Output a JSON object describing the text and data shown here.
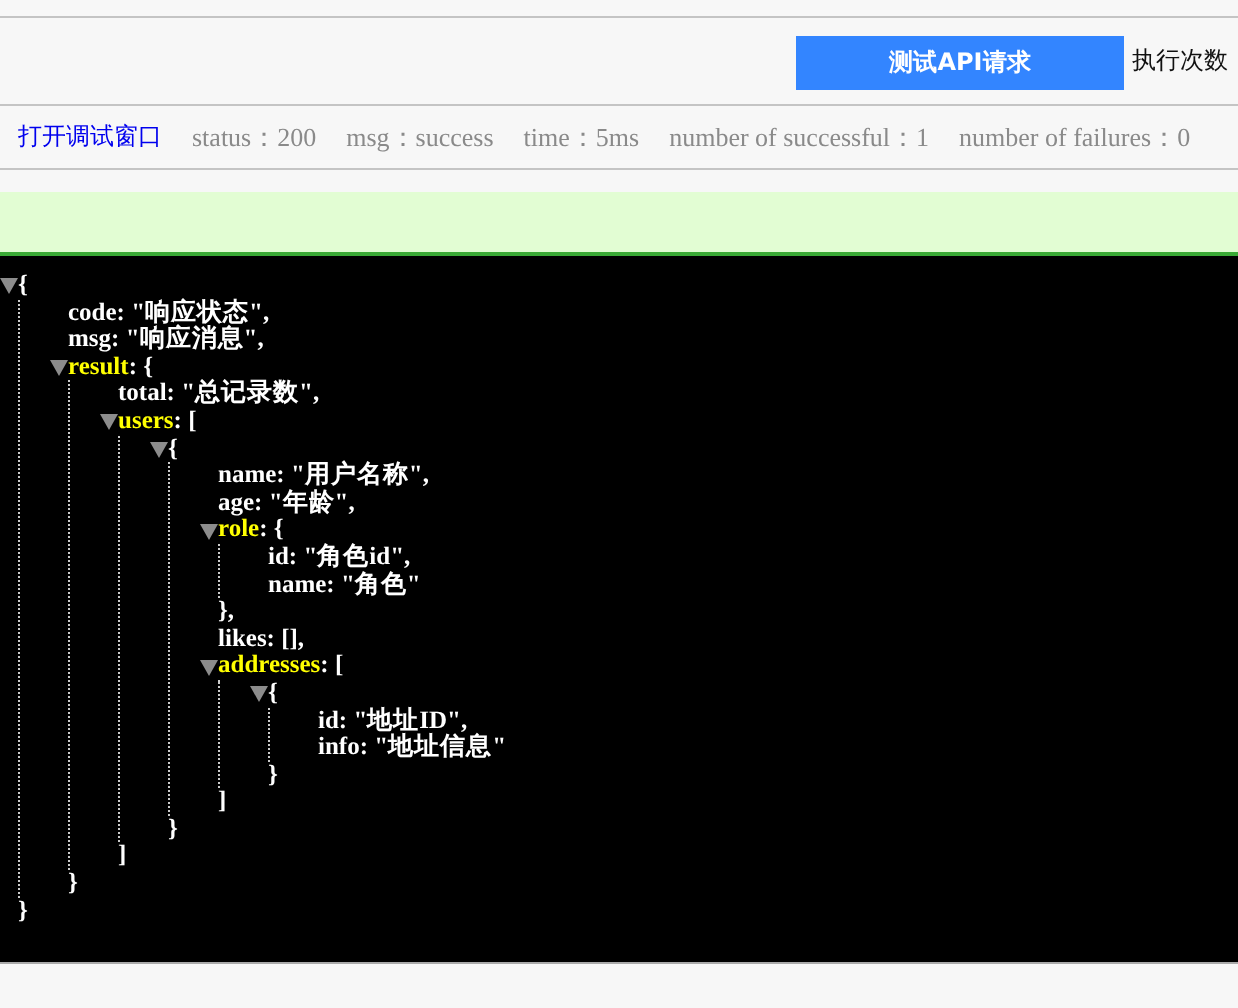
{
  "toolbar": {
    "button": "测试API请求",
    "run_count_label": "执行次数"
  },
  "status_bar": {
    "link": "打开调试窗口",
    "items": [
      "status：200",
      "msg：success",
      "time：5ms",
      "number of successful：1",
      "number of failures：0"
    ]
  },
  "json_tree": {
    "kind": "object",
    "open": "{",
    "close": "}",
    "expanded": true,
    "children": [
      {
        "kind": "value",
        "text": "code: \"响应状态\","
      },
      {
        "kind": "value",
        "text": "msg: \"响应消息\","
      },
      {
        "kind": "object",
        "key": "result",
        "open": ": {",
        "close": "}",
        "expanded": true,
        "children": [
          {
            "kind": "value",
            "text": "total: \"总记录数\","
          },
          {
            "kind": "object",
            "key": "users",
            "open": ": [",
            "close": "]",
            "expanded": true,
            "children": [
              {
                "kind": "object",
                "open": "{",
                "close": "}",
                "expanded": true,
                "children": [
                  {
                    "kind": "value",
                    "text": "name: \"用户名称\","
                  },
                  {
                    "kind": "value",
                    "text": "age: \"年龄\","
                  },
                  {
                    "kind": "object",
                    "key": "role",
                    "open": ": {",
                    "close": "},",
                    "expanded": true,
                    "children": [
                      {
                        "kind": "value",
                        "text": "id: \"角色id\","
                      },
                      {
                        "kind": "value",
                        "text": "name: \"角色\""
                      }
                    ]
                  },
                  {
                    "kind": "value",
                    "text": "likes: [],"
                  },
                  {
                    "kind": "object",
                    "key": "addresses",
                    "open": ": [",
                    "close": "]",
                    "expanded": true,
                    "children": [
                      {
                        "kind": "object",
                        "open": "{",
                        "close": "}",
                        "expanded": true,
                        "children": [
                          {
                            "kind": "value",
                            "text": "id: \"地址ID\","
                          },
                          {
                            "kind": "value",
                            "text": "info: \"地址信息\""
                          }
                        ]
                      }
                    ]
                  }
                ]
              }
            ]
          }
        ]
      }
    ]
  }
}
